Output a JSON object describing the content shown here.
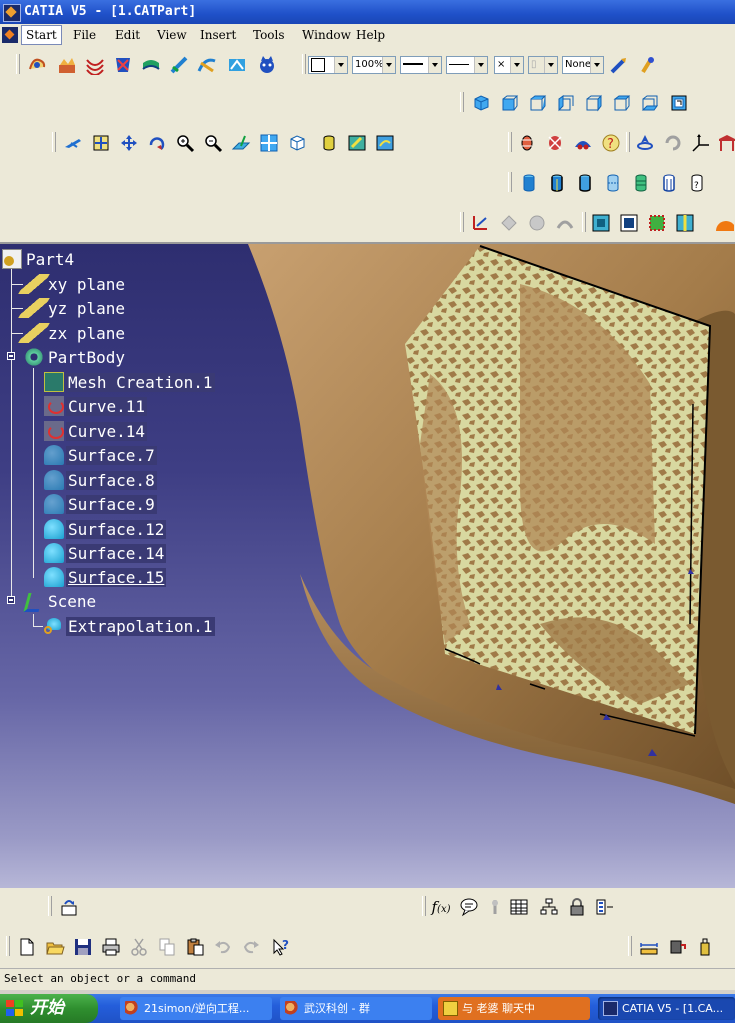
{
  "window": {
    "title": "CATIA V5 - [1.CATPart]"
  },
  "menu": {
    "items": [
      {
        "label": "Start",
        "key": "S"
      },
      {
        "label": "File",
        "key": "F"
      },
      {
        "label": "Edit",
        "key": "E"
      },
      {
        "label": "View",
        "key": "V"
      },
      {
        "label": "Insert",
        "key": "I"
      },
      {
        "label": "Tools",
        "key": "T"
      },
      {
        "label": "Window",
        "key": "W"
      },
      {
        "label": "Help",
        "key": "H"
      }
    ]
  },
  "properties_toolbar": {
    "zoom_value": "100%",
    "layer_value": "None"
  },
  "tree": {
    "root": "Part4",
    "planes": [
      "xy plane",
      "yz plane",
      "zx plane"
    ],
    "body": "PartBody",
    "features": [
      {
        "label": "Mesh Creation.1",
        "icon": "mesh-icon"
      },
      {
        "label": "Curve.11",
        "icon": "curve-icon"
      },
      {
        "label": "Curve.14",
        "icon": "curve-icon"
      },
      {
        "label": "Surface.7",
        "icon": "surface-hidden-icon"
      },
      {
        "label": "Surface.8",
        "icon": "surface-hidden-icon"
      },
      {
        "label": "Surface.9",
        "icon": "surface-hidden-icon"
      },
      {
        "label": "Surface.12",
        "icon": "surface-icon"
      },
      {
        "label": "Surface.14",
        "icon": "surface-icon"
      },
      {
        "label": "Surface.15",
        "icon": "surface-icon"
      }
    ],
    "scene": "Scene",
    "scene_child": "Extrapolation.1"
  },
  "status": {
    "text": "Select an object or a command"
  },
  "taskbar": {
    "start_label": "开始",
    "tasks": [
      {
        "label": "21simon/逆向工程..."
      },
      {
        "label": "武汉科创 - 群"
      },
      {
        "label": "与 老婆 聊天中"
      },
      {
        "label": "CATIA V5 - [1.CA..."
      }
    ]
  },
  "colors": {
    "viewport_top": "#2e2e70",
    "model_bronze": "#a47c4a",
    "surface_yellow": "#d8d8a0",
    "taskbar_blue": "#245edb",
    "start_green": "#2f8f2f"
  }
}
